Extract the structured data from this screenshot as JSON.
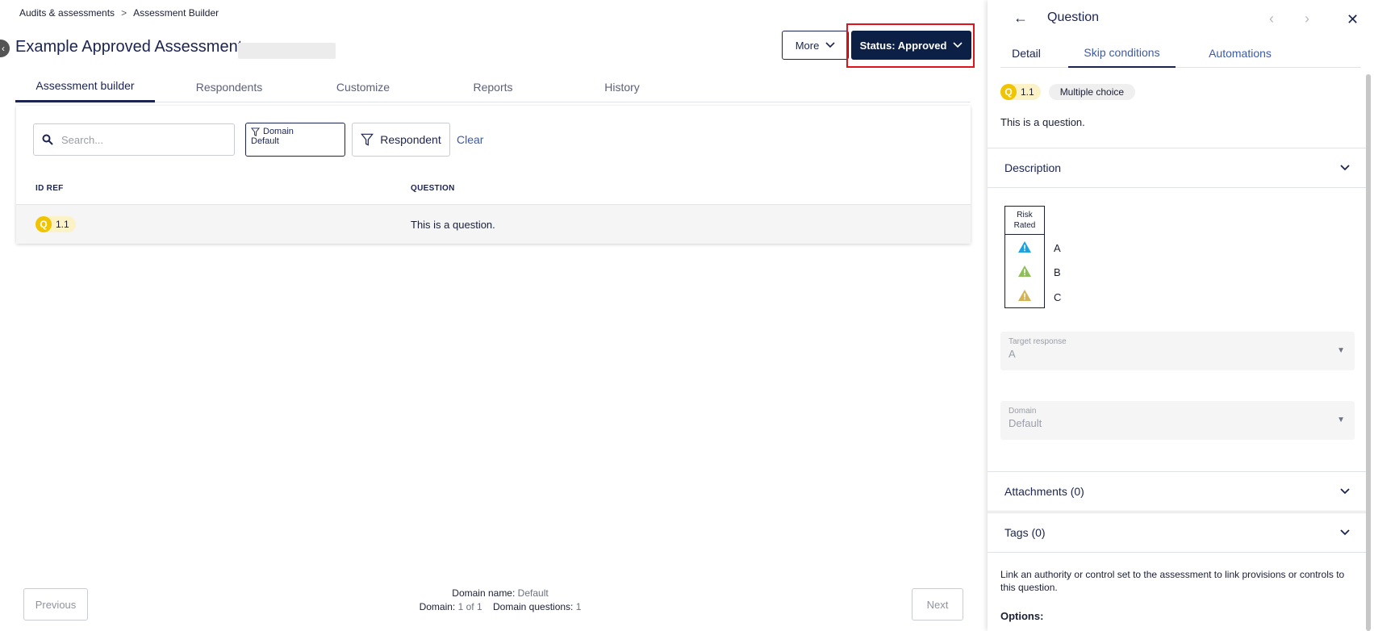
{
  "breadcrumb": {
    "items": [
      "Audits & assessments",
      "Assessment Builder"
    ],
    "separator": ">"
  },
  "header": {
    "title": "Example Approved Assessment",
    "more_label": "More",
    "status_label": "Status: Approved"
  },
  "tabs": [
    "Assessment builder",
    "Respondents",
    "Customize",
    "Reports",
    "History"
  ],
  "filters": {
    "search_placeholder": "Search...",
    "domain_label": "Domain",
    "domain_value": "Default",
    "respondent_label": "Respondent",
    "clear_label": "Clear"
  },
  "table": {
    "columns": [
      "ID REF",
      "QUESTION"
    ],
    "rows": [
      {
        "type_letter": "Q",
        "id_ref": "1.1",
        "question": "This is a question."
      }
    ]
  },
  "footer": {
    "previous_label": "Previous",
    "next_label": "Next",
    "domain_name_label": "Domain name:",
    "domain_name_value": "Default",
    "domain_label": "Domain:",
    "domain_value": "1 of 1",
    "domain_questions_label": "Domain questions:",
    "domain_questions_value": "1"
  },
  "panel": {
    "title": "Question",
    "tabs": [
      "Detail",
      "Skip conditions",
      "Automations"
    ],
    "badge_letter": "Q",
    "badge_id": "1.1",
    "question_type": "Multiple choice",
    "question_text": "This is a question.",
    "description_label": "Description",
    "risk_header": "Risk Rated",
    "risk_options": [
      {
        "label": "A",
        "color": "#1aa3e0"
      },
      {
        "label": "B",
        "color": "#8fbd57"
      },
      {
        "label": "C",
        "color": "#d4b256"
      }
    ],
    "target_response_label": "Target response",
    "target_response_value": "A",
    "domain_field_label": "Domain",
    "domain_field_value": "Default",
    "attachments_label": "Attachments (0)",
    "tags_label": "Tags (0)",
    "link_text": "Link an authority or control set to the assessment to link provisions or controls to this question.",
    "options_label": "Options:"
  },
  "colors": {
    "navy": "#0c1f45",
    "accent_link": "#3c5aa6",
    "highlight": "#e0131a",
    "badge_yellow": "#f0c400"
  }
}
